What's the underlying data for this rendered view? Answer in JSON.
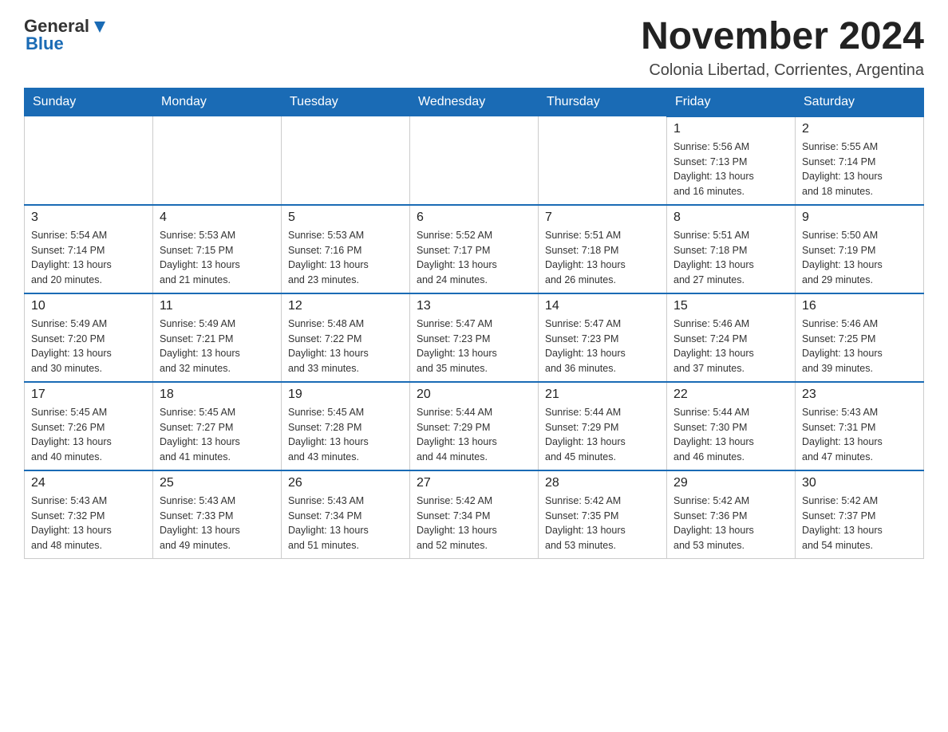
{
  "header": {
    "logo": {
      "text_general": "General",
      "text_blue": "Blue",
      "aria": "GeneralBlue logo"
    },
    "title": "November 2024",
    "subtitle": "Colonia Libertad, Corrientes, Argentina"
  },
  "calendar": {
    "headers": [
      "Sunday",
      "Monday",
      "Tuesday",
      "Wednesday",
      "Thursday",
      "Friday",
      "Saturday"
    ],
    "weeks": [
      [
        {
          "day": "",
          "info": ""
        },
        {
          "day": "",
          "info": ""
        },
        {
          "day": "",
          "info": ""
        },
        {
          "day": "",
          "info": ""
        },
        {
          "day": "",
          "info": ""
        },
        {
          "day": "1",
          "info": "Sunrise: 5:56 AM\nSunset: 7:13 PM\nDaylight: 13 hours\nand 16 minutes."
        },
        {
          "day": "2",
          "info": "Sunrise: 5:55 AM\nSunset: 7:14 PM\nDaylight: 13 hours\nand 18 minutes."
        }
      ],
      [
        {
          "day": "3",
          "info": "Sunrise: 5:54 AM\nSunset: 7:14 PM\nDaylight: 13 hours\nand 20 minutes."
        },
        {
          "day": "4",
          "info": "Sunrise: 5:53 AM\nSunset: 7:15 PM\nDaylight: 13 hours\nand 21 minutes."
        },
        {
          "day": "5",
          "info": "Sunrise: 5:53 AM\nSunset: 7:16 PM\nDaylight: 13 hours\nand 23 minutes."
        },
        {
          "day": "6",
          "info": "Sunrise: 5:52 AM\nSunset: 7:17 PM\nDaylight: 13 hours\nand 24 minutes."
        },
        {
          "day": "7",
          "info": "Sunrise: 5:51 AM\nSunset: 7:18 PM\nDaylight: 13 hours\nand 26 minutes."
        },
        {
          "day": "8",
          "info": "Sunrise: 5:51 AM\nSunset: 7:18 PM\nDaylight: 13 hours\nand 27 minutes."
        },
        {
          "day": "9",
          "info": "Sunrise: 5:50 AM\nSunset: 7:19 PM\nDaylight: 13 hours\nand 29 minutes."
        }
      ],
      [
        {
          "day": "10",
          "info": "Sunrise: 5:49 AM\nSunset: 7:20 PM\nDaylight: 13 hours\nand 30 minutes."
        },
        {
          "day": "11",
          "info": "Sunrise: 5:49 AM\nSunset: 7:21 PM\nDaylight: 13 hours\nand 32 minutes."
        },
        {
          "day": "12",
          "info": "Sunrise: 5:48 AM\nSunset: 7:22 PM\nDaylight: 13 hours\nand 33 minutes."
        },
        {
          "day": "13",
          "info": "Sunrise: 5:47 AM\nSunset: 7:23 PM\nDaylight: 13 hours\nand 35 minutes."
        },
        {
          "day": "14",
          "info": "Sunrise: 5:47 AM\nSunset: 7:23 PM\nDaylight: 13 hours\nand 36 minutes."
        },
        {
          "day": "15",
          "info": "Sunrise: 5:46 AM\nSunset: 7:24 PM\nDaylight: 13 hours\nand 37 minutes."
        },
        {
          "day": "16",
          "info": "Sunrise: 5:46 AM\nSunset: 7:25 PM\nDaylight: 13 hours\nand 39 minutes."
        }
      ],
      [
        {
          "day": "17",
          "info": "Sunrise: 5:45 AM\nSunset: 7:26 PM\nDaylight: 13 hours\nand 40 minutes."
        },
        {
          "day": "18",
          "info": "Sunrise: 5:45 AM\nSunset: 7:27 PM\nDaylight: 13 hours\nand 41 minutes."
        },
        {
          "day": "19",
          "info": "Sunrise: 5:45 AM\nSunset: 7:28 PM\nDaylight: 13 hours\nand 43 minutes."
        },
        {
          "day": "20",
          "info": "Sunrise: 5:44 AM\nSunset: 7:29 PM\nDaylight: 13 hours\nand 44 minutes."
        },
        {
          "day": "21",
          "info": "Sunrise: 5:44 AM\nSunset: 7:29 PM\nDaylight: 13 hours\nand 45 minutes."
        },
        {
          "day": "22",
          "info": "Sunrise: 5:44 AM\nSunset: 7:30 PM\nDaylight: 13 hours\nand 46 minutes."
        },
        {
          "day": "23",
          "info": "Sunrise: 5:43 AM\nSunset: 7:31 PM\nDaylight: 13 hours\nand 47 minutes."
        }
      ],
      [
        {
          "day": "24",
          "info": "Sunrise: 5:43 AM\nSunset: 7:32 PM\nDaylight: 13 hours\nand 48 minutes."
        },
        {
          "day": "25",
          "info": "Sunrise: 5:43 AM\nSunset: 7:33 PM\nDaylight: 13 hours\nand 49 minutes."
        },
        {
          "day": "26",
          "info": "Sunrise: 5:43 AM\nSunset: 7:34 PM\nDaylight: 13 hours\nand 51 minutes."
        },
        {
          "day": "27",
          "info": "Sunrise: 5:42 AM\nSunset: 7:34 PM\nDaylight: 13 hours\nand 52 minutes."
        },
        {
          "day": "28",
          "info": "Sunrise: 5:42 AM\nSunset: 7:35 PM\nDaylight: 13 hours\nand 53 minutes."
        },
        {
          "day": "29",
          "info": "Sunrise: 5:42 AM\nSunset: 7:36 PM\nDaylight: 13 hours\nand 53 minutes."
        },
        {
          "day": "30",
          "info": "Sunrise: 5:42 AM\nSunset: 7:37 PM\nDaylight: 13 hours\nand 54 minutes."
        }
      ]
    ]
  }
}
